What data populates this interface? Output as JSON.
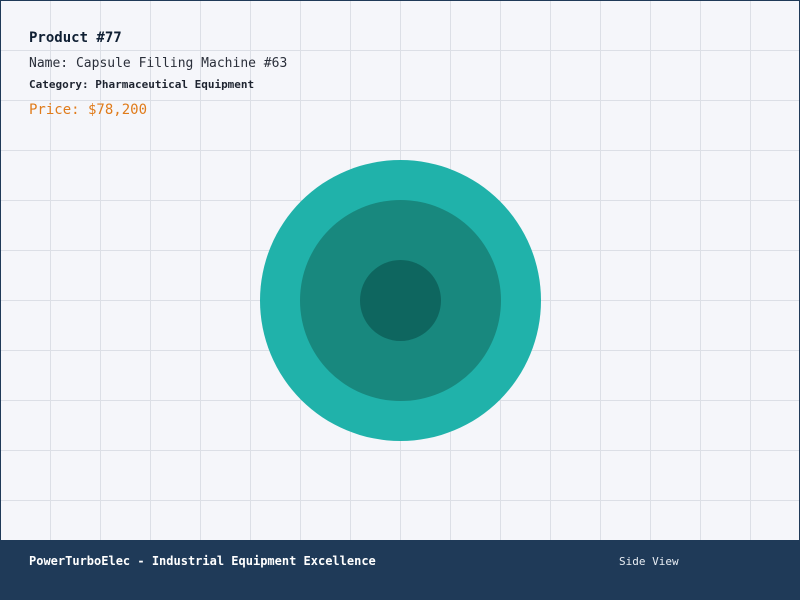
{
  "product": {
    "id_label": "Product #77",
    "name_label": "Name: Capsule Filling Machine #63",
    "category_key": "Category:",
    "category_value": "Pharmaceutical Equipment",
    "price_label": "Price: $78,200"
  },
  "illustration": {
    "icon": "capsule-filling-machine-top-view",
    "colors": {
      "outer": "#20b2aa",
      "middle": "#18887e",
      "inner": "#0e665f"
    }
  },
  "footer": {
    "brand": "PowerTurboElec - Industrial Equipment Excellence",
    "view_label": "Side View"
  },
  "colors": {
    "background": "#f5f6fa",
    "grid": "#dcdfe6",
    "footer": "#1f3a58",
    "price": "#e07b1a"
  }
}
